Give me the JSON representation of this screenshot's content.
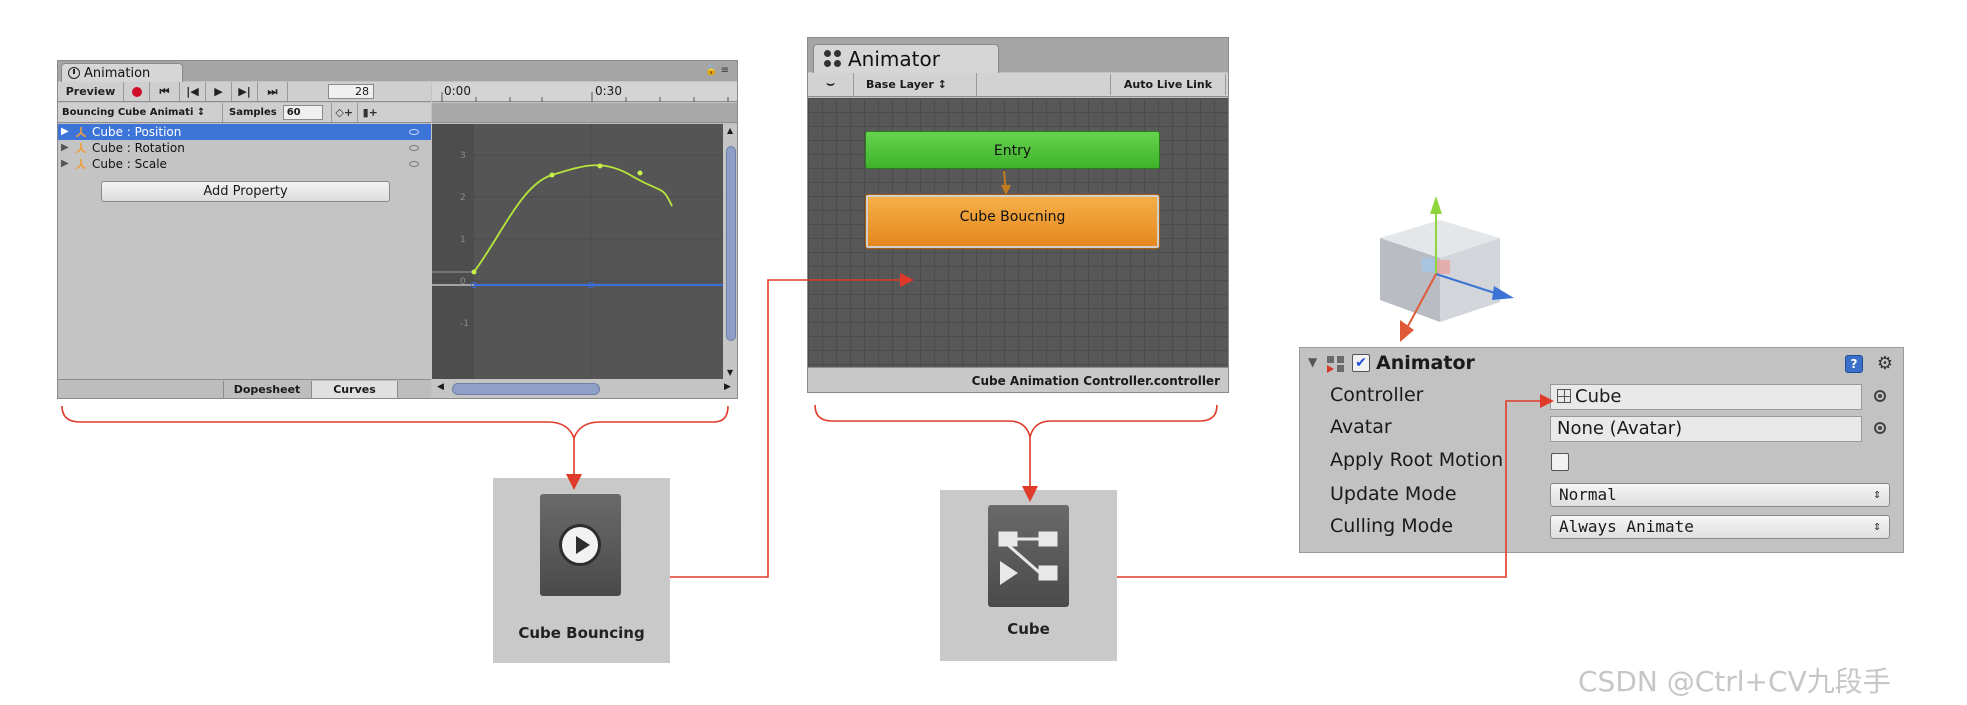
{
  "animation_window": {
    "tab_title": "Animation",
    "preview_label": "Preview",
    "frame_value": "28",
    "clip_selector": "Bouncing Cube Animati ↕",
    "samples_label": "Samples",
    "samples_value": "60",
    "properties": [
      {
        "label": "Cube : Position"
      },
      {
        "label": "Cube : Rotation"
      },
      {
        "label": "Cube : Scale"
      }
    ],
    "add_property_label": "Add Property",
    "tab_dopesheet": "Dopesheet",
    "tab_curves": "Curves",
    "timeline_marks": [
      "0:00",
      "0:30"
    ],
    "curve_axis_labels": [
      "3",
      "2",
      "1",
      "0",
      "-1"
    ]
  },
  "animator_window": {
    "tab_title": "Animator",
    "layer_label": "Base Layer ↕",
    "auto_live_link_label": "Auto Live Link",
    "entry_state": "Entry",
    "default_state": "Cube Boucning",
    "status_text": "Cube Animation Controller.controller"
  },
  "assets": {
    "clip_label": "Cube Bouncing",
    "controller_label": "Cube"
  },
  "inspector": {
    "component_title": "Animator",
    "controller_label": "Controller",
    "controller_value": "Cube",
    "avatar_label": "Avatar",
    "avatar_value": "None (Avatar)",
    "root_motion_label": "Apply Root Motion",
    "update_mode_label": "Update Mode",
    "update_mode_value": "Normal",
    "culling_mode_label": "Culling Mode",
    "culling_mode_value": "Always Animate"
  },
  "colors": {
    "connector": "#e03a2a",
    "selection": "#3d74d8",
    "entry_node": "#4fc239",
    "default_state_node": "#ee9a2f",
    "position_curve": "#b5e83a",
    "flat_curve": "#3a6fe0"
  },
  "watermark": "CSDN @Ctrl+CV九段手"
}
